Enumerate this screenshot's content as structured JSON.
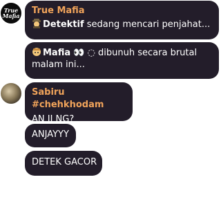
{
  "messages": [
    {
      "sender": "True Mafia",
      "avatar_text_1": "True",
      "avatar_text_2": "Mafia",
      "line1_bold": "Detektif",
      "line1_rest": " sedang mencari penjahat...",
      "line2_bold": "Mafia",
      "line2_rest": " 👀 ◌ dibunuh secara brutal",
      "line3": "malam ini..."
    },
    {
      "sender": "Sabiru #chehkhodam",
      "texts": [
        "AN JI NG?",
        "ANJAYYY",
        "DETEK GACOR"
      ]
    }
  ],
  "colors": {
    "bubble": "#231d2a",
    "sender_name": "#f0a35a",
    "text": "#ffffff"
  }
}
